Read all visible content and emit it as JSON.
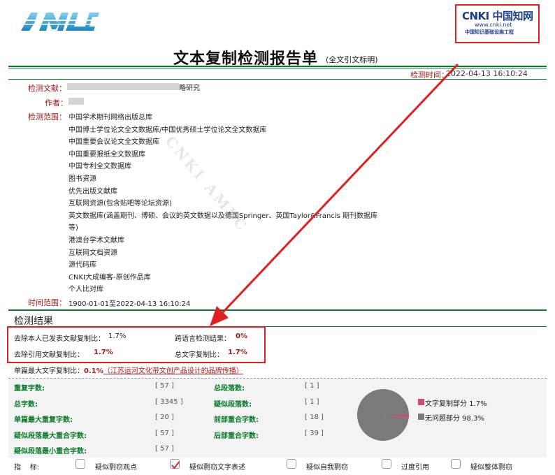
{
  "header": {
    "logo_text": "AMLC",
    "cnki_name": "CNKI 中国知网",
    "cnki_url": "www.cnki.net",
    "cnki_tagline": "中国知识基础设施工程",
    "title": "文本复制检测报告单",
    "subtitle": "(全文引文标明)",
    "detect_time_label": "检测时间：",
    "detect_time": "2022-04-13 16:10:24"
  },
  "doc": {
    "doc_label": "检测文献：",
    "doc_title_visible": "略研究",
    "author_label": "作者：",
    "scope_label": "检测范围：",
    "databases": [
      "中国学术期刊网络出版总库",
      "中国博士学位论文全文数据库/中国优秀硕士学位论文全文数据库",
      "中国重要会议论文全文数据库",
      "中国重要报纸全文数据库",
      "中国专利全文数据库",
      "图书资源",
      "优先出版文献库",
      "互联网资源(包含贴吧等论坛资源)",
      "英文数据库(涵盖期刊、博硕、会议的英文数据以及德国Springer、英国Taylor&Francis 期刊数据库",
      "等)",
      "港澳台学术文献库",
      "互联网文档资源",
      "源代码库",
      "CNKI大成编客-原创作品库",
      "个人比对库"
    ],
    "time_range_label": "时间范围：",
    "time_range": "1900-01-01至2022-04-13 16:10:24",
    "watermark": "CNKI AMLC"
  },
  "result": {
    "heading": "检测结果",
    "self_excl_label": "去除本人已发表文献复制比：",
    "self_excl_value": "1.7%",
    "cross_lang_label": "跨语言检测结果：",
    "cross_lang_value": "0%",
    "cite_excl_label": "去除引用文献复制比：",
    "cite_excl_value": "1.7%",
    "total_label": "总文字复制比：",
    "total_value": "1.7%",
    "single_max_label": "单篇最大文字复制比：",
    "single_max_value": "0.1%",
    "single_max_source": "（江苏运河文化带文创产品设计的品牌传播）"
  },
  "stats": {
    "left": [
      {
        "label": "重复字数:",
        "value": "[ 57 ]"
      },
      {
        "label": "总字数:",
        "value": "[ 3345 ]"
      },
      {
        "label": "单篇最大重复字数:",
        "value": "[ 20 ]"
      },
      {
        "label": "疑似段落最大重合字数:",
        "value": "[ 57 ]"
      },
      {
        "label": "疑似段落最小重合字数:",
        "value": "[ 57 ]"
      }
    ],
    "right": [
      {
        "label": "总段落数:",
        "value": "[ 1 ]"
      },
      {
        "label": "疑似段落数:",
        "value": "[ 1 ]"
      },
      {
        "label": "前部重合字数:",
        "value": "[ 18 ]"
      },
      {
        "label": "后部重合字数:",
        "value": "[ 39 ]"
      }
    ]
  },
  "chart_data": {
    "type": "pie",
    "slices": [
      {
        "label": "文字复制部分",
        "value": 1.7,
        "text": "文字复制部分 1.7%",
        "color": "#d04a6a"
      },
      {
        "label": "无问题部分",
        "value": 98.3,
        "text": "无问题部分 98.3%",
        "color": "#7a7a7a"
      }
    ]
  },
  "indicators": {
    "label": "指    标:",
    "items": [
      {
        "text": "疑似剽窃观点",
        "checked": false
      },
      {
        "text": "疑似剽窃文字表述",
        "checked": true
      },
      {
        "text": "疑似自我剽窃",
        "checked": false
      },
      {
        "text": "过度引用",
        "checked": false
      },
      {
        "text": "疑似整体剽窃",
        "checked": false
      }
    ]
  },
  "colors": {
    "accent_green": "#0c7b2c",
    "label_red": "#a41818",
    "highlight_red": "#e02020"
  }
}
